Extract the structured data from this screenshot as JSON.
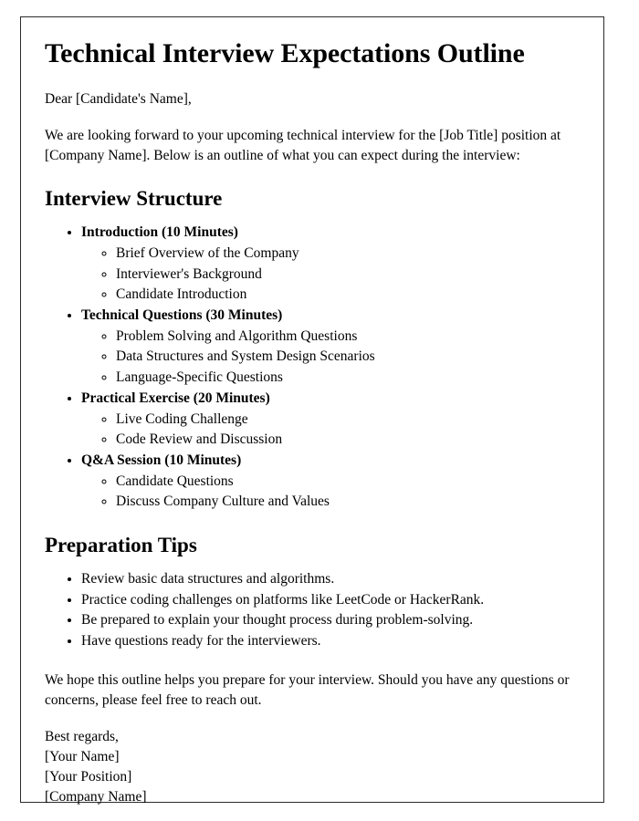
{
  "document": {
    "title": "Technical Interview Expectations Outline",
    "salutation": "Dear [Candidate's Name],",
    "intro_paragraph": "We are looking forward to your upcoming technical interview for the [Job Title] position at [Company Name]. Below is an outline of what you can expect during the interview:",
    "sections": [
      {
        "heading": "Interview Structure",
        "items": [
          {
            "label": "Introduction (10 Minutes)",
            "subitems": [
              "Brief Overview of the Company",
              "Interviewer's Background",
              "Candidate Introduction"
            ]
          },
          {
            "label": "Technical Questions (30 Minutes)",
            "subitems": [
              "Problem Solving and Algorithm Questions",
              "Data Structures and System Design Scenarios",
              "Language-Specific Questions"
            ]
          },
          {
            "label": "Practical Exercise (20 Minutes)",
            "subitems": [
              "Live Coding Challenge",
              "Code Review and Discussion"
            ]
          },
          {
            "label": "Q&A Session (10 Minutes)",
            "subitems": [
              "Candidate Questions",
              "Discuss Company Culture and Values"
            ]
          }
        ]
      },
      {
        "heading": "Preparation Tips",
        "tips": [
          "Review basic data structures and algorithms.",
          "Practice coding challenges on platforms like LeetCode or HackerRank.",
          "Be prepared to explain your thought process during problem-solving.",
          "Have questions ready for the interviewers."
        ]
      }
    ],
    "closing_paragraph": "We hope this outline helps you prepare for your interview. Should you have any questions or concerns, please feel free to reach out.",
    "signature": [
      "Best regards,",
      "[Your Name]",
      "[Your Position]",
      "[Company Name]"
    ]
  }
}
